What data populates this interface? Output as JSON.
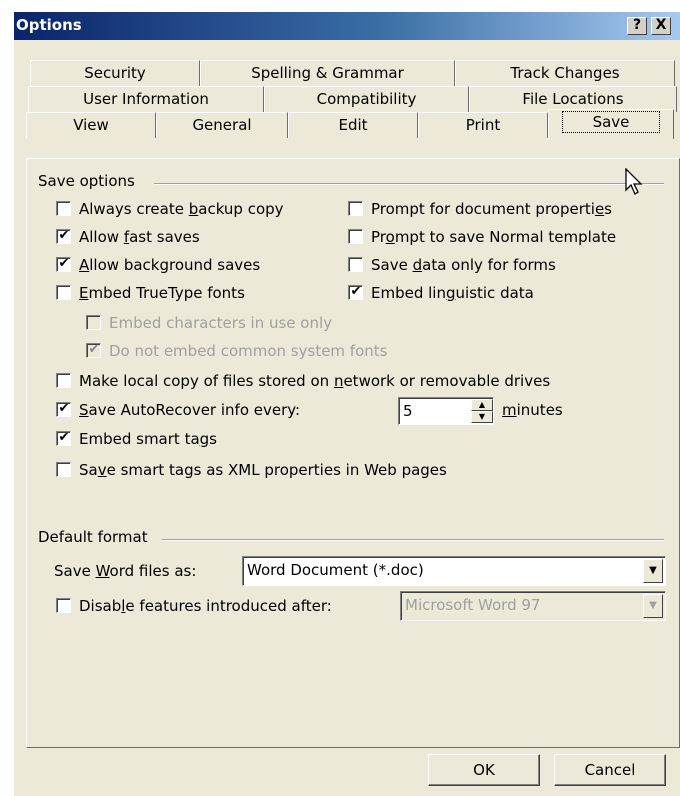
{
  "window": {
    "title": "Options",
    "help_label": "?",
    "close_label": "X"
  },
  "tabs": {
    "row1": [
      "Security",
      "Spelling & Grammar",
      "Track Changes"
    ],
    "row2": [
      "User Information",
      "Compatibility",
      "File Locations"
    ],
    "row3": [
      "View",
      "General",
      "Edit",
      "Print",
      "Save"
    ],
    "active": "Save"
  },
  "save_options": {
    "group_label": "Save options",
    "always_backup": {
      "pre": "Always create ",
      "key": "b",
      "post": "ackup copy",
      "checked": false
    },
    "allow_fast_saves": {
      "pre": "Allow ",
      "key": "f",
      "post": "ast saves",
      "checked": true
    },
    "allow_background_saves": {
      "pre": "",
      "key": "A",
      "post": "llow background saves",
      "checked": true
    },
    "embed_truetype": {
      "pre": "",
      "key": "E",
      "post": "mbed TrueType fonts",
      "checked": false
    },
    "embed_chars_in_use": {
      "label": "Embed characters in use only",
      "checked": false,
      "disabled": true
    },
    "no_common_system_fonts": {
      "label": "Do not embed common system fonts",
      "checked": true,
      "disabled": true
    },
    "prompt_doc_properties": {
      "pre": "Prompt for document properti",
      "key": "e",
      "post": "s",
      "checked": false
    },
    "prompt_normal_template": {
      "pre": "Pr",
      "key": "o",
      "post": "mpt to save Normal template",
      "checked": false
    },
    "save_data_forms": {
      "pre": "Save ",
      "key": "d",
      "post": "ata only for forms",
      "checked": false
    },
    "embed_linguistic": {
      "pre": "Embed lin",
      "key": "g",
      "post": "uistic data",
      "checked": true
    },
    "local_copy": {
      "pre": "Make local copy of files stored on ",
      "key": "n",
      "post": "etwork or removable drives",
      "checked": false
    },
    "autorecover": {
      "pre": "",
      "key": "S",
      "post": "ave AutoRecover info every:",
      "checked": true,
      "minutes_value": "5",
      "minutes_pre": "",
      "minutes_key": "m",
      "minutes_post": "inutes"
    },
    "embed_smart_tags": {
      "pre": "Embed smart ta",
      "key": "g",
      "post": "s",
      "checked": true
    },
    "smart_tags_xml": {
      "pre": "Sa",
      "key": "v",
      "post": "e smart tags as XML properties in Web pages",
      "checked": false
    }
  },
  "default_format": {
    "group_label": "Default format",
    "save_as_pre": "Save ",
    "save_as_key": "W",
    "save_as_post": "ord files as:",
    "save_as_value": "Word Document (*.doc)",
    "disable_features": {
      "pre": "Disab",
      "key": "l",
      "post": "e features introduced after:",
      "checked": false
    },
    "disable_features_value": "Microsoft Word 97"
  },
  "buttons": {
    "ok": "OK",
    "cancel": "Cancel"
  },
  "icons": {
    "checkmark": "✔",
    "dropdown": "▼",
    "spin_up": "▲",
    "spin_down": "▼"
  }
}
